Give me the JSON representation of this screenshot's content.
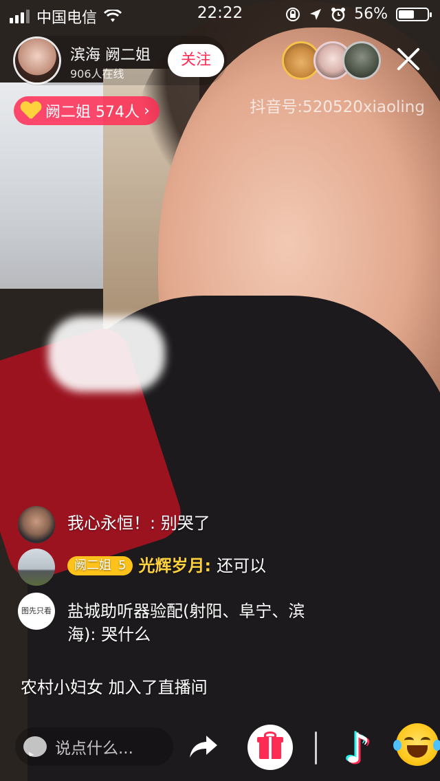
{
  "status_bar": {
    "carrier": "中国电信",
    "time": "22:22",
    "battery_percent": "56%",
    "battery_level": 0.56
  },
  "host": {
    "name": "滨海 阙二姐",
    "online": "906人在线",
    "follow_label": "关注"
  },
  "fan_club": {
    "label": "阙二姐 574人",
    "chevron": "›"
  },
  "douyin_id": "抖音号:520520xiaoling",
  "chat": [
    {
      "text": "我心永恒！: 别哭了"
    },
    {
      "badge_name": "阙二姐",
      "badge_level": "5",
      "user": "光辉岁月:",
      "message": "还可以"
    },
    {
      "avatar_text": "图先只看",
      "text": "盐城助听器验配(射阳、阜宁、滨海): 哭什么"
    }
  ],
  "join_notice": "农村小妇女 加入了直播间",
  "bottom": {
    "input_placeholder": "说点什么..."
  },
  "icons": {
    "share": "share-arrow-icon",
    "gift": "gift-icon",
    "tiktok": "tiktok-logo-icon",
    "emoji": "laughing-crying-emoji-icon",
    "close": "close-icon"
  },
  "colors": {
    "accent": "#fe2c55",
    "badge": "#ffc21a",
    "gold_text": "#ffd23d"
  }
}
